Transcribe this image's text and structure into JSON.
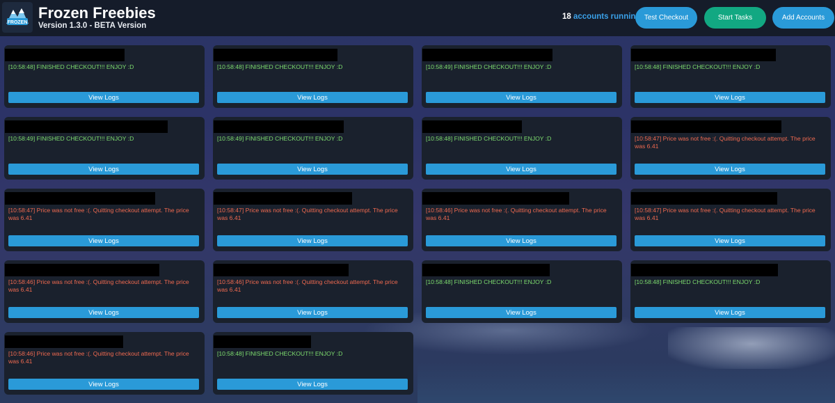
{
  "header": {
    "title": "Frozen Freebies",
    "version": "Version 1.3.0 - BETA Version",
    "accounts_count": "18",
    "accounts_label": "accounts running",
    "buttons": {
      "test_checkout": "Test Checkout",
      "start_tasks": "Start Tasks",
      "add_accounts": "Add Accounts"
    },
    "logo_text": "FROZEN"
  },
  "cards": [
    {
      "log": "[10:58:48] FINISHED CHECKOUT!!! ENJOY :D",
      "status": "ok",
      "button": "View Logs"
    },
    {
      "log": "[10:58:48] FINISHED CHECKOUT!!! ENJOY :D",
      "status": "ok",
      "button": "View Logs"
    },
    {
      "log": "[10:58:49] FINISHED CHECKOUT!!! ENJOY :D",
      "status": "ok",
      "button": "View Logs"
    },
    {
      "log": "[10:58:48] FINISHED CHECKOUT!!! ENJOY :D",
      "status": "ok",
      "button": "View Logs"
    },
    {
      "log": "[10:58:49] FINISHED CHECKOUT!!! ENJOY :D",
      "status": "ok",
      "button": "View Logs"
    },
    {
      "log": "[10:58:49] FINISHED CHECKOUT!!! ENJOY :D",
      "status": "ok",
      "button": "View Logs"
    },
    {
      "log": "[10:58:48] FINISHED CHECKOUT!!! ENJOY :D",
      "status": "ok",
      "button": "View Logs"
    },
    {
      "log": "[10:58:47] Price was not free :(. Quitting checkout attempt. The price was 6.41",
      "status": "err",
      "button": "View Logs"
    },
    {
      "log": "[10:58:47] Price was not free :(. Quitting checkout attempt. The price was 6.41",
      "status": "err",
      "button": "View Logs"
    },
    {
      "log": "[10:58:47] Price was not free :(. Quitting checkout attempt. The price was 6.41",
      "status": "err",
      "button": "View Logs"
    },
    {
      "log": "[10:58:46] Price was not free :(. Quitting checkout attempt. The price was 6.41",
      "status": "err",
      "button": "View Logs"
    },
    {
      "log": "[10:58:47] Price was not free :(. Quitting checkout attempt. The price was 6.41",
      "status": "err",
      "button": "View Logs"
    },
    {
      "log": "[10:58:46] Price was not free :(. Quitting checkout attempt. The price was 6.41",
      "status": "err",
      "button": "View Logs"
    },
    {
      "log": "[10:58:46] Price was not free :(. Quitting checkout attempt. The price was 6.41",
      "status": "err",
      "button": "View Logs"
    },
    {
      "log": "[10:58:48] FINISHED CHECKOUT!!! ENJOY :D",
      "status": "ok",
      "button": "View Logs"
    },
    {
      "log": "[10:58:48] FINISHED CHECKOUT!!! ENJOY :D",
      "status": "ok",
      "button": "View Logs"
    },
    {
      "log": "[10:58:46] Price was not free :(. Quitting checkout attempt. The price was 6.41",
      "status": "err",
      "button": "View Logs"
    },
    {
      "log": "[10:58:48] FINISHED CHECKOUT!!! ENJOY :D",
      "status": "ok",
      "button": "View Logs"
    }
  ],
  "colors": {
    "ok": "#7ddc6e",
    "err": "#f06a50",
    "primary": "#2a9ad8",
    "start": "#12a882"
  }
}
